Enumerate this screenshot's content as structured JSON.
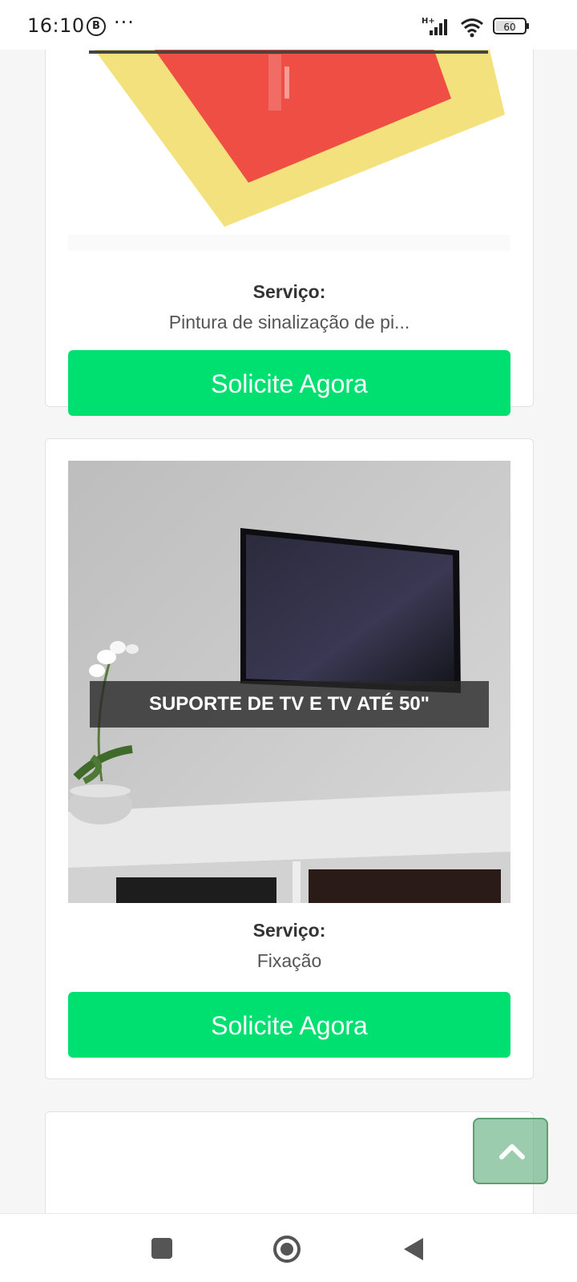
{
  "status_bar": {
    "time": "16:10",
    "notification_badge": "B",
    "more": "···",
    "network_type": "H+",
    "battery": "60"
  },
  "cards": [
    {
      "service_label": "Serviço:",
      "service_value": "Pintura de sinalização de pi...",
      "button_label": "Solicite Agora"
    },
    {
      "image_title": "SUPORTE DE TV E TV ATÉ 50\"",
      "service_label": "Serviço:",
      "service_value": "Fixação",
      "button_label": "Solicite Agora"
    }
  ],
  "colors": {
    "accent_green": "#00e070",
    "scroll_top_bg": "#8fc8a3"
  },
  "icons": {
    "scroll_top": "chevron-up-icon",
    "nav_recents": "square-icon",
    "nav_home": "circle-icon",
    "nav_back": "triangle-back-icon"
  }
}
